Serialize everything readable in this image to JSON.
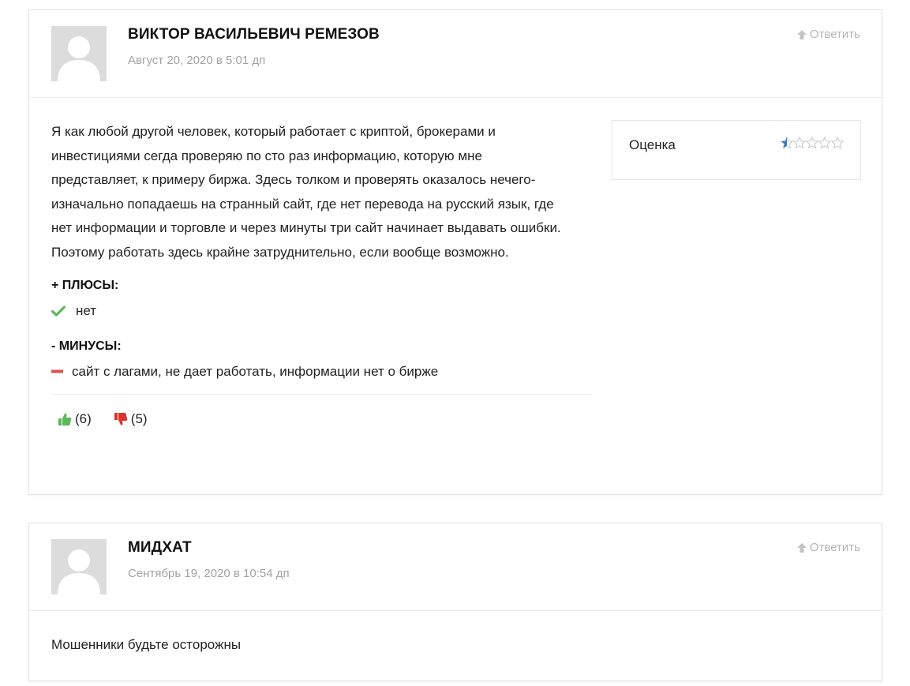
{
  "reviews": [
    {
      "author": "ВИКТОР ВАСИЛЬЕВИЧ РЕМЕЗОВ",
      "date": "Август 20, 2020 в 5:01 дп",
      "reply_label": "Ответить",
      "text": "Я как любой другой человек, который работает с криптой, брокерами и инвестициями сегда проверяю по сто раз информацию, которую мне представляет, к примеру биржа. Здесь толком и проверять оказалось нечего- изначально попадаешь на странный сайт, где нет перевода на русский язык, где нет информации и торговле и через минуты три сайт начинает выдавать ошибки. Поэтому работать здесь крайне затруднительно, если вообще возможно.",
      "rating_label": "Оценка",
      "rating_value": 0.5,
      "rating_max": 5,
      "pros_title": "+ ПЛЮСЫ:",
      "pros": [
        "нет"
      ],
      "cons_title": "- МИНУСЫ:",
      "cons": [
        "сайт с лагами, не дает работать, информации нет о бирже"
      ],
      "likes": "(6)",
      "dislikes": "(5)"
    },
    {
      "author": "МИДХАТ",
      "date": "Сентябрь 19, 2020 в 10:54 дп",
      "reply_label": "Ответить",
      "text": "Мошенники будьте осторожны"
    }
  ],
  "colors": {
    "check": "#5cb85c",
    "minus": "#e05050",
    "like": "#5cb85c",
    "dislike": "#d9342b",
    "star_fill": "#3b7dbf",
    "star_empty": "#c8c8c8",
    "muted": "#a2a2a2"
  },
  "icons": {
    "avatar": "user-silhouette-icon",
    "reply": "arrow-up-icon",
    "star": "star-icon",
    "check": "check-icon",
    "minus": "minus-icon",
    "like": "thumbs-up-icon",
    "dislike": "thumbs-down-icon"
  }
}
